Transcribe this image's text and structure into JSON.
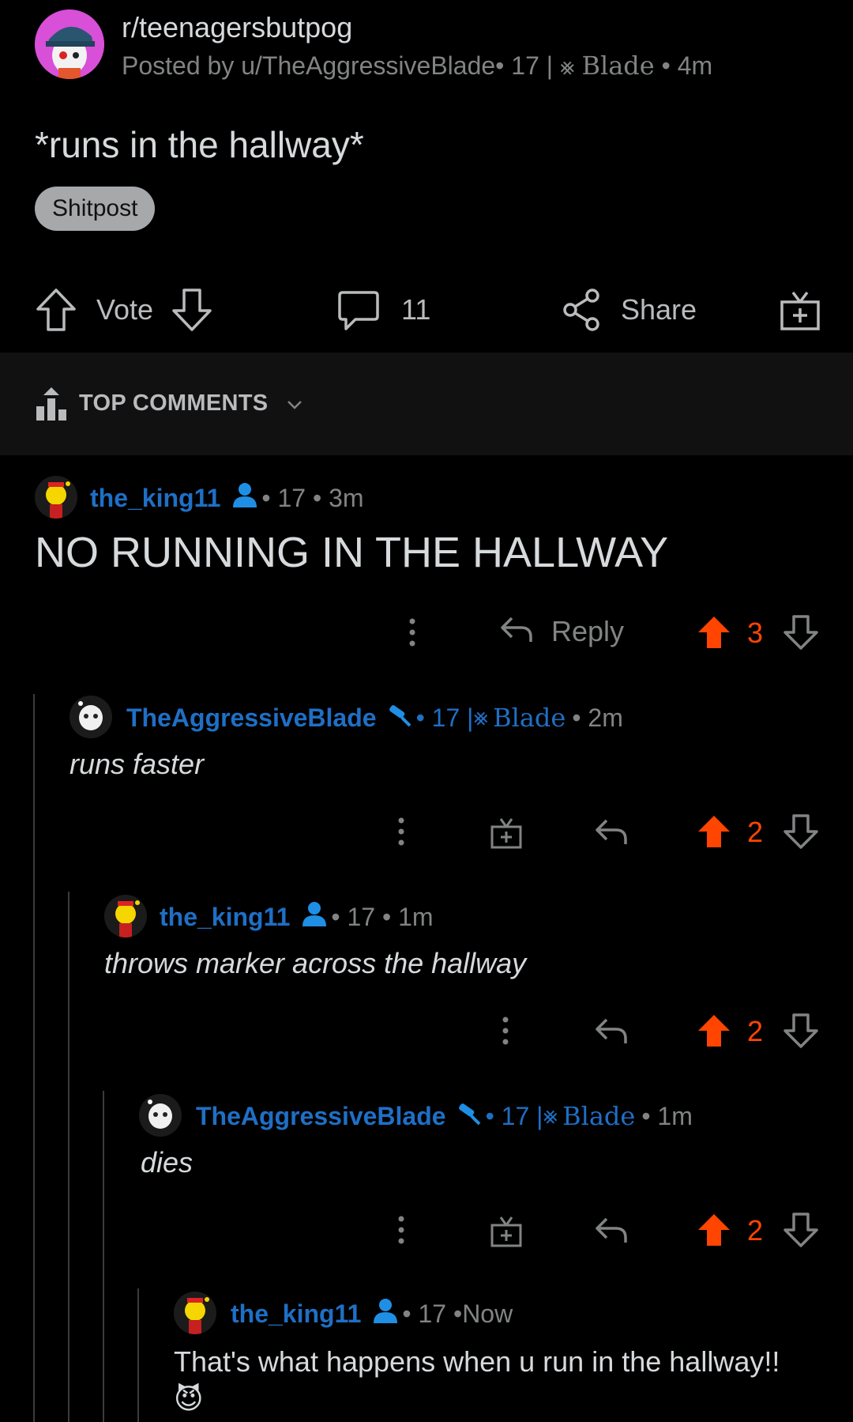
{
  "post": {
    "subreddit": "r/teenagersbutpog",
    "posted_by": "Posted by u/TheAggressiveBlade",
    "author_flair_age": "• 17 | ",
    "author_flair_name": "Blade",
    "age": "• 4m",
    "title": "*runs in the hallway*",
    "flair": "Shitpost"
  },
  "actions": {
    "vote_label": "Vote",
    "comment_count": "11",
    "share_label": "Share"
  },
  "top_comments": {
    "label": "TOP COMMENTS"
  },
  "comments": [
    {
      "user": "the_king11",
      "meta": "• 17 • 3m",
      "body": "NO RUNNING IN THE HALLWAY",
      "reply_label": "Reply",
      "votes": "3"
    },
    {
      "user": "TheAggressiveBlade",
      "meta_age": "• 17 | ",
      "flair_name": "Blade",
      "time": "• 2m",
      "body": "runs faster",
      "votes": "2"
    },
    {
      "user": "the_king11",
      "meta": "• 17 • 1m",
      "body": "throws marker across the hallway",
      "votes": "2"
    },
    {
      "user": "TheAggressiveBlade",
      "meta_age": "• 17 | ",
      "flair_name": "Blade",
      "time": "• 1m",
      "body": "dies",
      "votes": "2"
    },
    {
      "user": "the_king11",
      "meta": "• 17 • ",
      "time": "Now",
      "body": "That's what happens when u run in the hallway!!",
      "emoji": "😈"
    }
  ],
  "colors": {
    "accent": "#ff4500",
    "username": "#1f6fc5",
    "background": "#000000"
  }
}
